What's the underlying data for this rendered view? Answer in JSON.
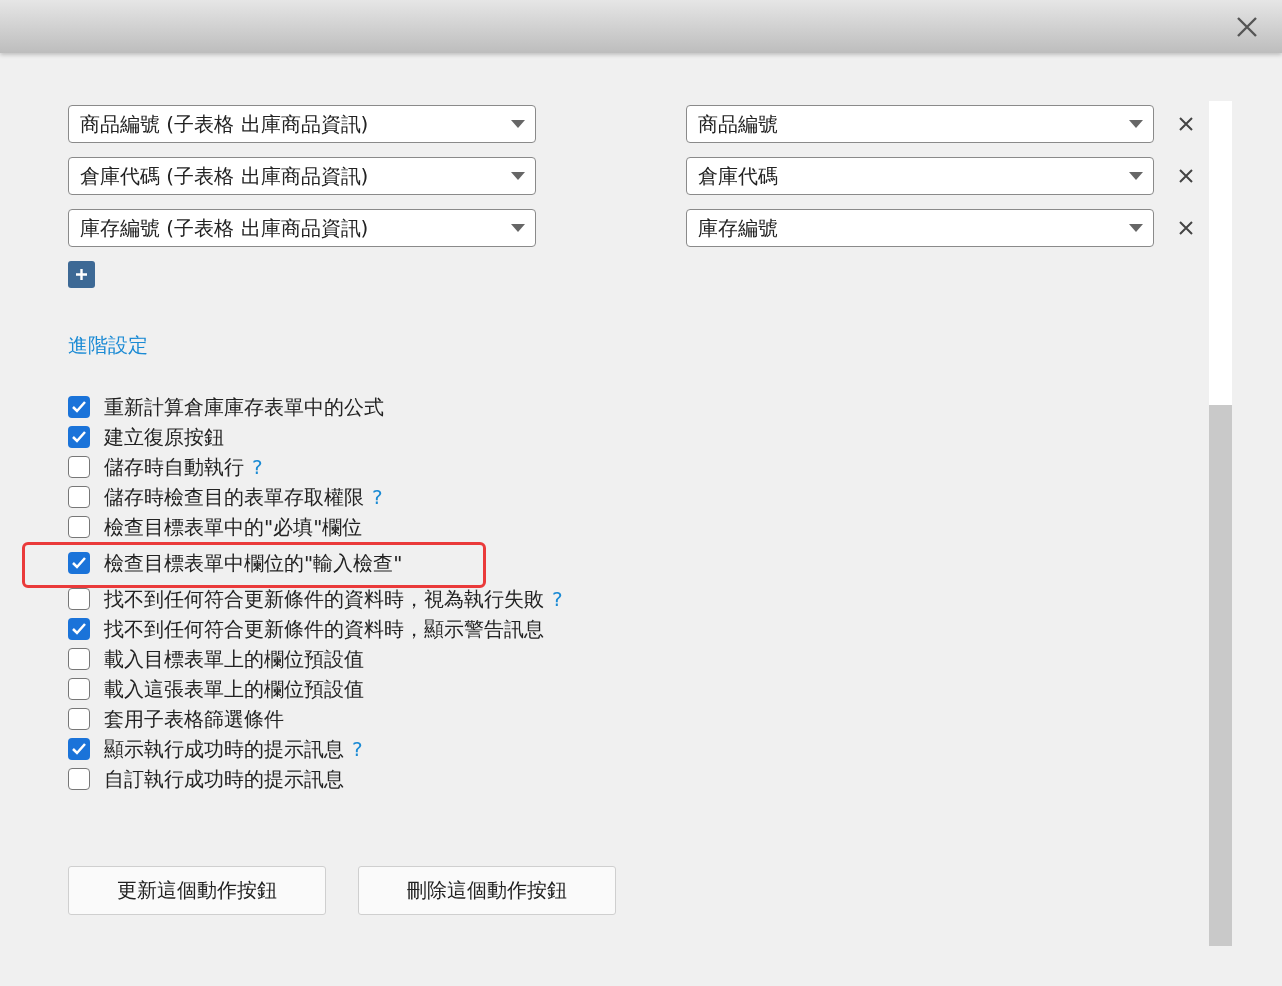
{
  "mappings": [
    {
      "source": "商品編號 (子表格 出庫商品資訊)",
      "target": "商品編號"
    },
    {
      "source": "倉庫代碼 (子表格 出庫商品資訊)",
      "target": "倉庫代碼"
    },
    {
      "source": "庫存編號 (子表格 出庫商品資訊)",
      "target": "庫存編號"
    }
  ],
  "advanced_link": "進階設定",
  "options": [
    {
      "label": "重新計算倉庫庫存表單中的公式",
      "checked": true,
      "highlighted": false
    },
    {
      "label": "建立復原按鈕",
      "checked": true,
      "highlighted": false
    },
    {
      "label": "儲存時自動執行",
      "checked": false,
      "help": "?",
      "highlighted": false
    },
    {
      "label": "儲存時檢查目的表單存取權限",
      "checked": false,
      "help": "?",
      "highlighted": false
    },
    {
      "label": "檢查目標表單中的\"必填\"欄位",
      "checked": false,
      "highlighted": false
    },
    {
      "label": "檢查目標表單中欄位的\"輸入檢查\"",
      "checked": true,
      "highlighted": true
    },
    {
      "label": "找不到任何符合更新條件的資料時，視為執行失敗",
      "checked": false,
      "help": "?",
      "highlighted": false
    },
    {
      "label": "找不到任何符合更新條件的資料時，顯示警告訊息",
      "checked": true,
      "highlighted": false
    },
    {
      "label": "載入目標表單上的欄位預設值",
      "checked": false,
      "highlighted": false
    },
    {
      "label": "載入這張表單上的欄位預設值",
      "checked": false,
      "highlighted": false
    },
    {
      "label": "套用子表格篩選條件",
      "checked": false,
      "highlighted": false
    },
    {
      "label": "顯示執行成功時的提示訊息",
      "checked": true,
      "help": "?",
      "highlighted": false
    },
    {
      "label": "自訂執行成功時的提示訊息",
      "checked": false,
      "highlighted": false
    }
  ],
  "buttons": [
    "更新這個動作按鈕",
    "刪除這個動作按鈕"
  ]
}
